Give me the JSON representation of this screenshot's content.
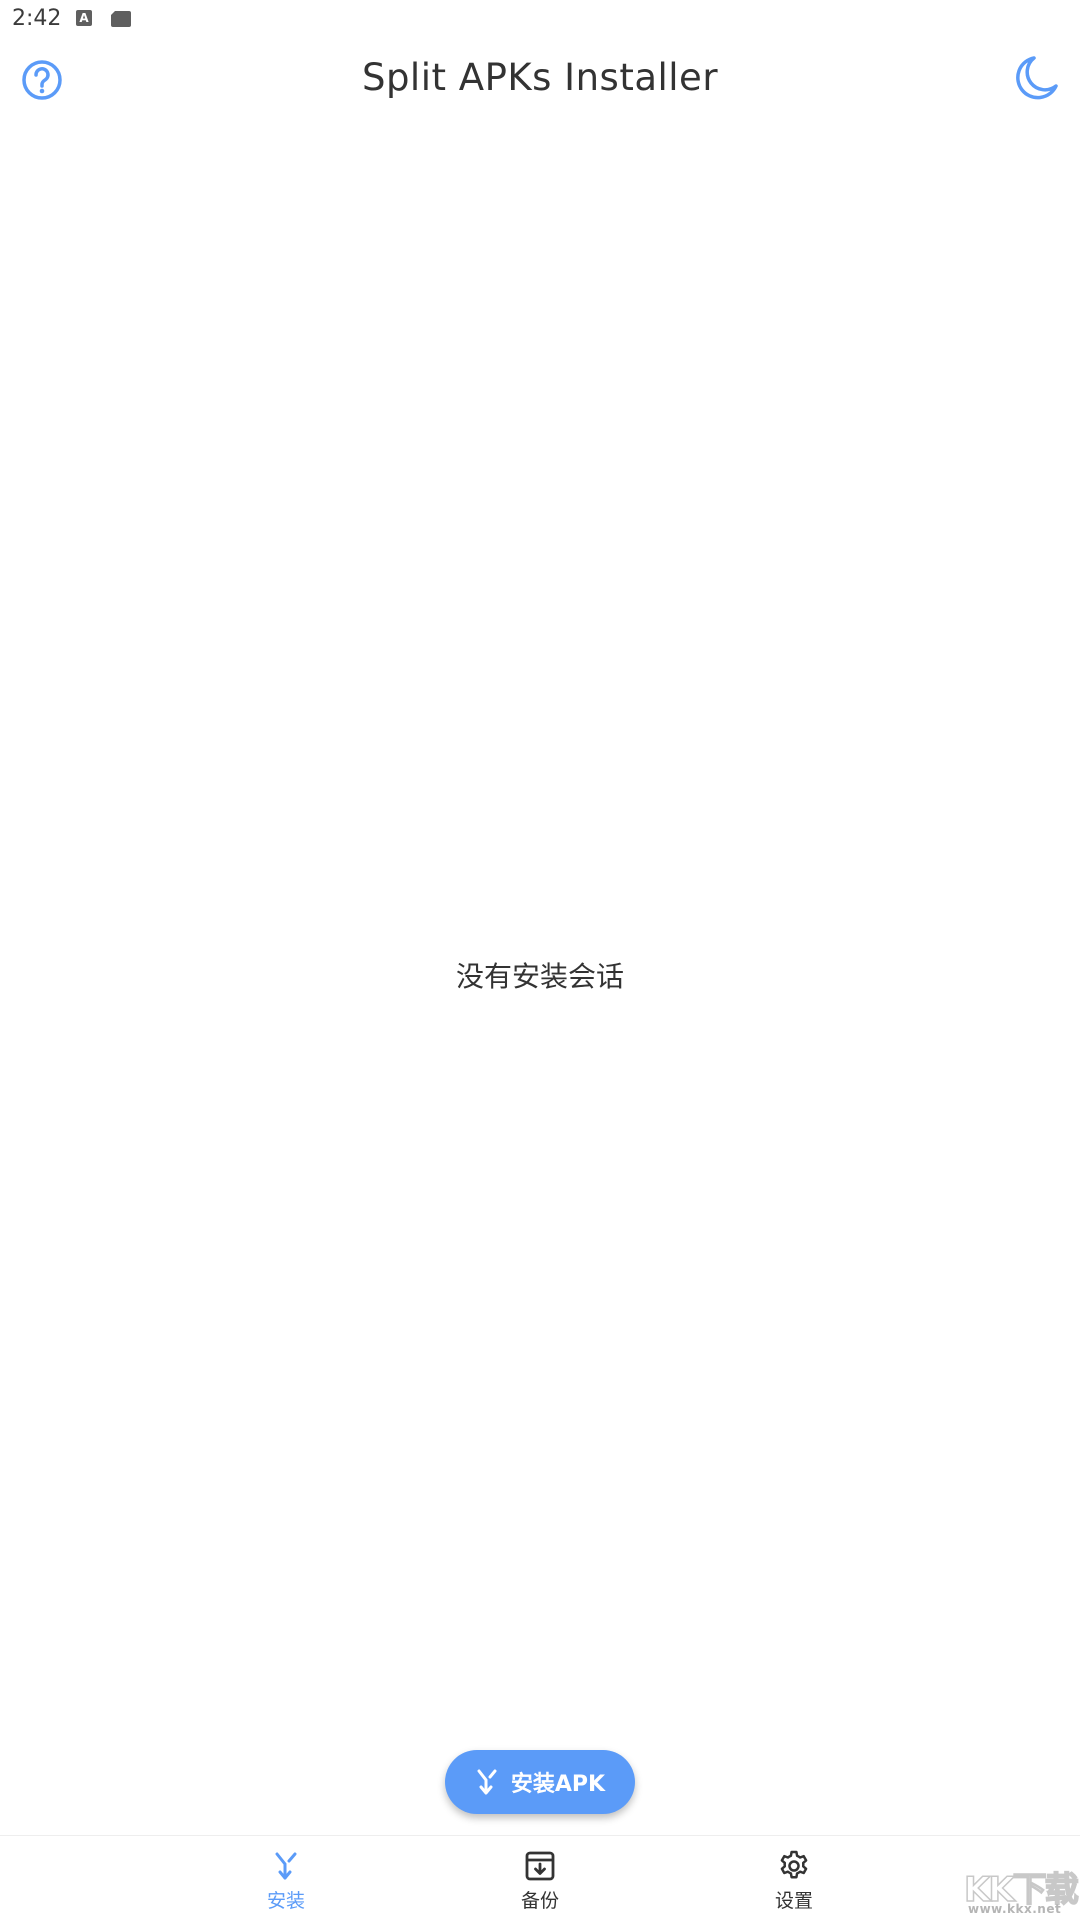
{
  "status_bar": {
    "time": "2:42"
  },
  "app_bar": {
    "title": "Split APKs Installer",
    "help_icon": "help-circle-icon",
    "theme_icon": "moon-icon"
  },
  "main": {
    "empty_message": "没有安装会话"
  },
  "fab": {
    "label": "安装APK",
    "icon": "merge-icon"
  },
  "bottom_nav": {
    "items": [
      {
        "label": "安装",
        "icon": "merge-icon",
        "active": true
      },
      {
        "label": "备份",
        "icon": "archive-icon",
        "active": false
      },
      {
        "label": "设置",
        "icon": "gear-icon",
        "active": false
      }
    ]
  },
  "watermark": {
    "logo": "KK下载",
    "url": "www.kkx.net"
  },
  "colors": {
    "accent": "#5b9bf8",
    "text": "#333333",
    "background": "#ffffff"
  }
}
